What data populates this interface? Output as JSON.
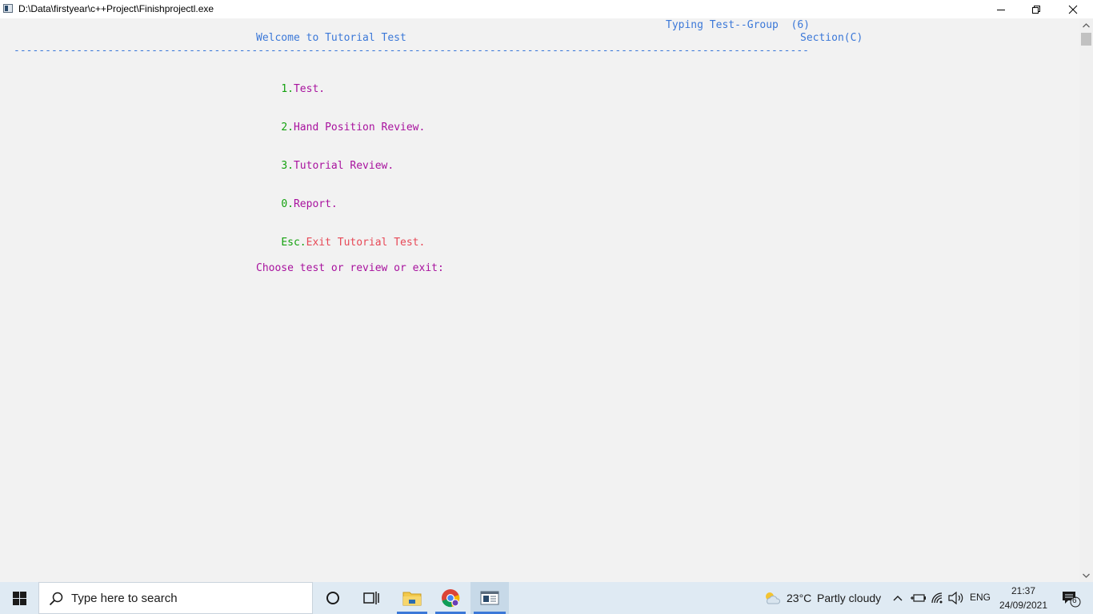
{
  "window": {
    "title": "D:\\Data\\firstyear\\c++Project\\Finishprojectl.exe"
  },
  "console": {
    "header_group": "Typing Test--Group  (6)",
    "welcome": "Welcome to Tutorial Test",
    "section": "Section(C)",
    "separator": "-------------------------------------------------------------------------------------------------------------------------------",
    "menu": [
      {
        "key": "1.",
        "label": "Test."
      },
      {
        "key": "2.",
        "label": "Hand Position Review."
      },
      {
        "key": "3.",
        "label": "Tutorial Review."
      },
      {
        "key": "0.",
        "label": "Report."
      },
      {
        "key": "Esc.",
        "label": "Exit Tutorial Test."
      }
    ],
    "prompt": "Choose test or review or exit:"
  },
  "colors": {
    "blue": "#3b78d8",
    "green": "#13a10e",
    "magenta": "#a8129e",
    "red": "#e74856"
  },
  "taskbar": {
    "search_placeholder": "Type here to search",
    "weather_temp": "23°C",
    "weather_desc": "Partly cloudy",
    "language": "ENG",
    "time": "21:37",
    "date": "24/09/2021",
    "notification_count": "6"
  }
}
